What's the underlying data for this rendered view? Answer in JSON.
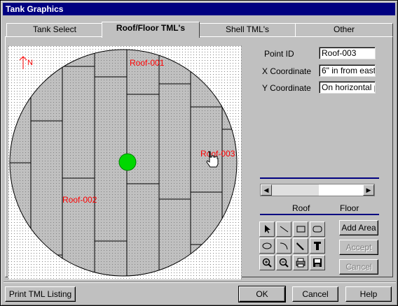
{
  "window": {
    "title": "Tank Graphics"
  },
  "tabs": [
    {
      "label": "Tank Select",
      "active": false
    },
    {
      "label": "Roof/Floor TML's",
      "active": true
    },
    {
      "label": "Shell TML's",
      "active": false
    },
    {
      "label": "Other",
      "active": false
    }
  ],
  "canvas": {
    "north_label": "N",
    "point_labels": [
      "Roof-001",
      "Roof-002",
      "Roof-003"
    ],
    "label_color": "#ff0000",
    "center_marker_color": "#00d800"
  },
  "fields": {
    "point_id": {
      "label": "Point ID",
      "value": "Roof-003"
    },
    "x_coord": {
      "label": "X Coordinate",
      "value": "6\" in from east"
    },
    "y_coord": {
      "label": "Y Coordinate",
      "value": "On horizontal pl"
    }
  },
  "segment": {
    "roof_label": "Roof",
    "floor_label": "Floor"
  },
  "tools": [
    "pointer-icon",
    "line-icon",
    "rectangle-icon",
    "rounded-rectangle-icon",
    "ellipse-icon",
    "arc-icon",
    "brush-icon",
    "text-icon",
    "zoom-in-icon",
    "zoom-out-icon",
    "print-icon",
    "save-icon"
  ],
  "side_buttons": {
    "add_area": "Add Area",
    "accept": "Accept",
    "cancel": "Cancel"
  },
  "footer": {
    "print": "Print TML Listing",
    "ok": "OK",
    "cancel": "Cancel",
    "help": "Help"
  },
  "colors": {
    "title_bar": "#000080",
    "accent_line": "#000080"
  }
}
